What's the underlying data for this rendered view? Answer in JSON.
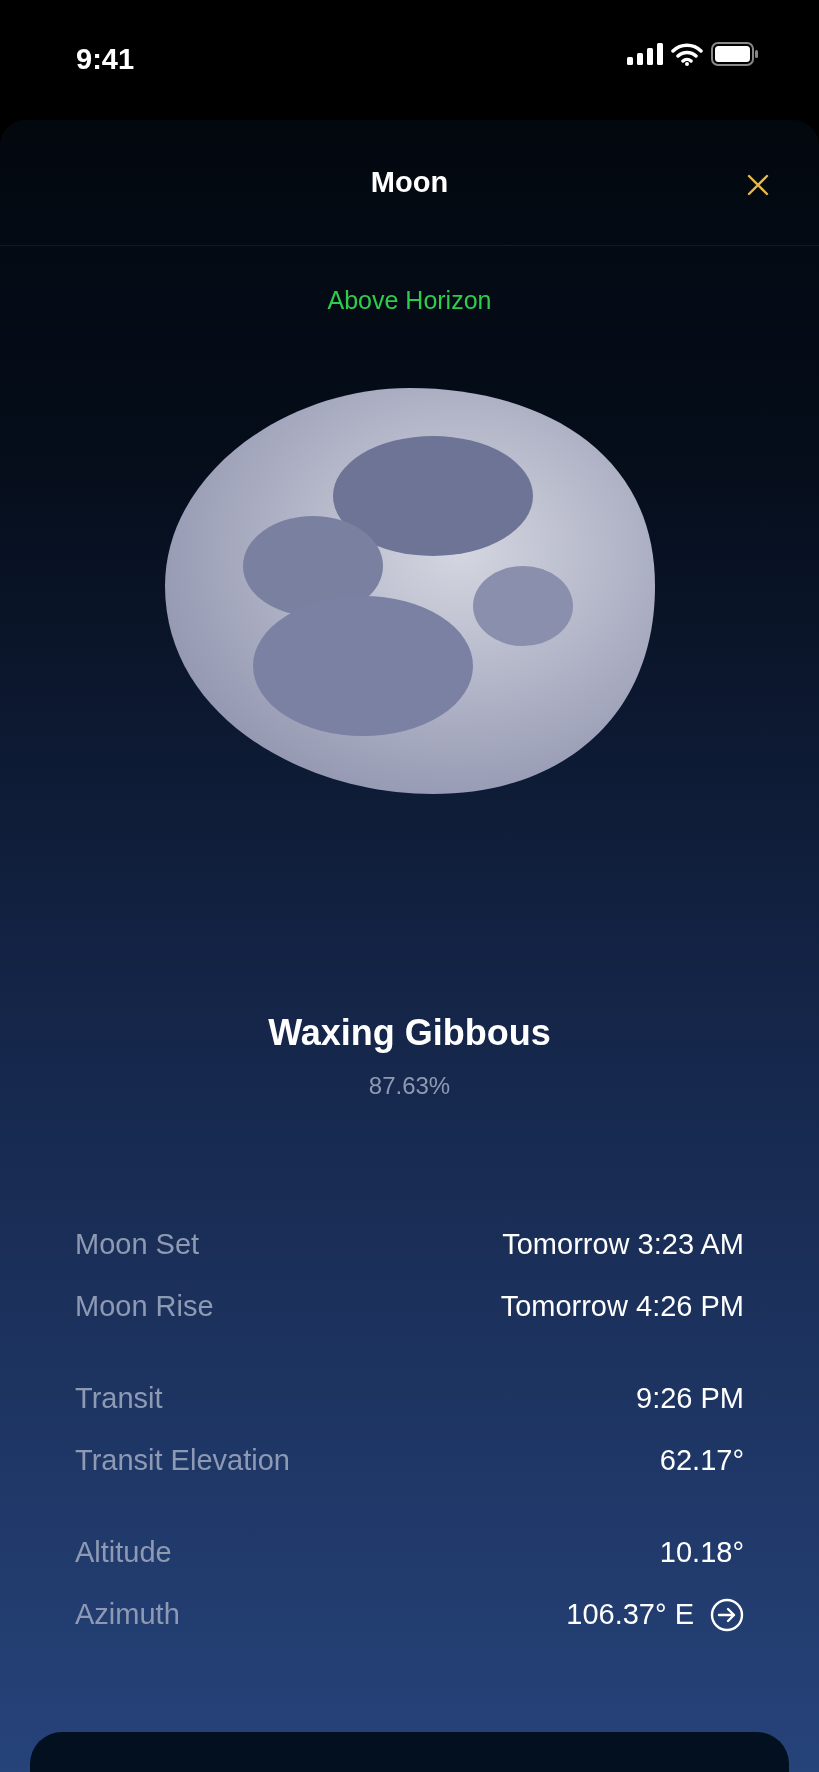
{
  "status_bar": {
    "time": "9:41"
  },
  "sheet": {
    "title": "Moon",
    "status": "Above Horizon"
  },
  "phase": {
    "name": "Waxing Gibbous",
    "illumination": "87.63%"
  },
  "detail_groups": [
    {
      "rows": [
        {
          "label": "Moon Set",
          "value": "Tomorrow 3:23 AM",
          "kind": "plain"
        },
        {
          "label": "Moon Rise",
          "value": "Tomorrow 4:26 PM",
          "kind": "plain"
        }
      ]
    },
    {
      "rows": [
        {
          "label": "Transit",
          "value": "9:26 PM",
          "kind": "plain"
        },
        {
          "label": "Transit Elevation",
          "value": "62.17°",
          "kind": "plain"
        }
      ]
    },
    {
      "rows": [
        {
          "label": "Altitude",
          "value": "10.18°",
          "kind": "plain"
        },
        {
          "label": "Azimuth",
          "value": "106.37° E",
          "kind": "direction"
        }
      ]
    }
  ]
}
